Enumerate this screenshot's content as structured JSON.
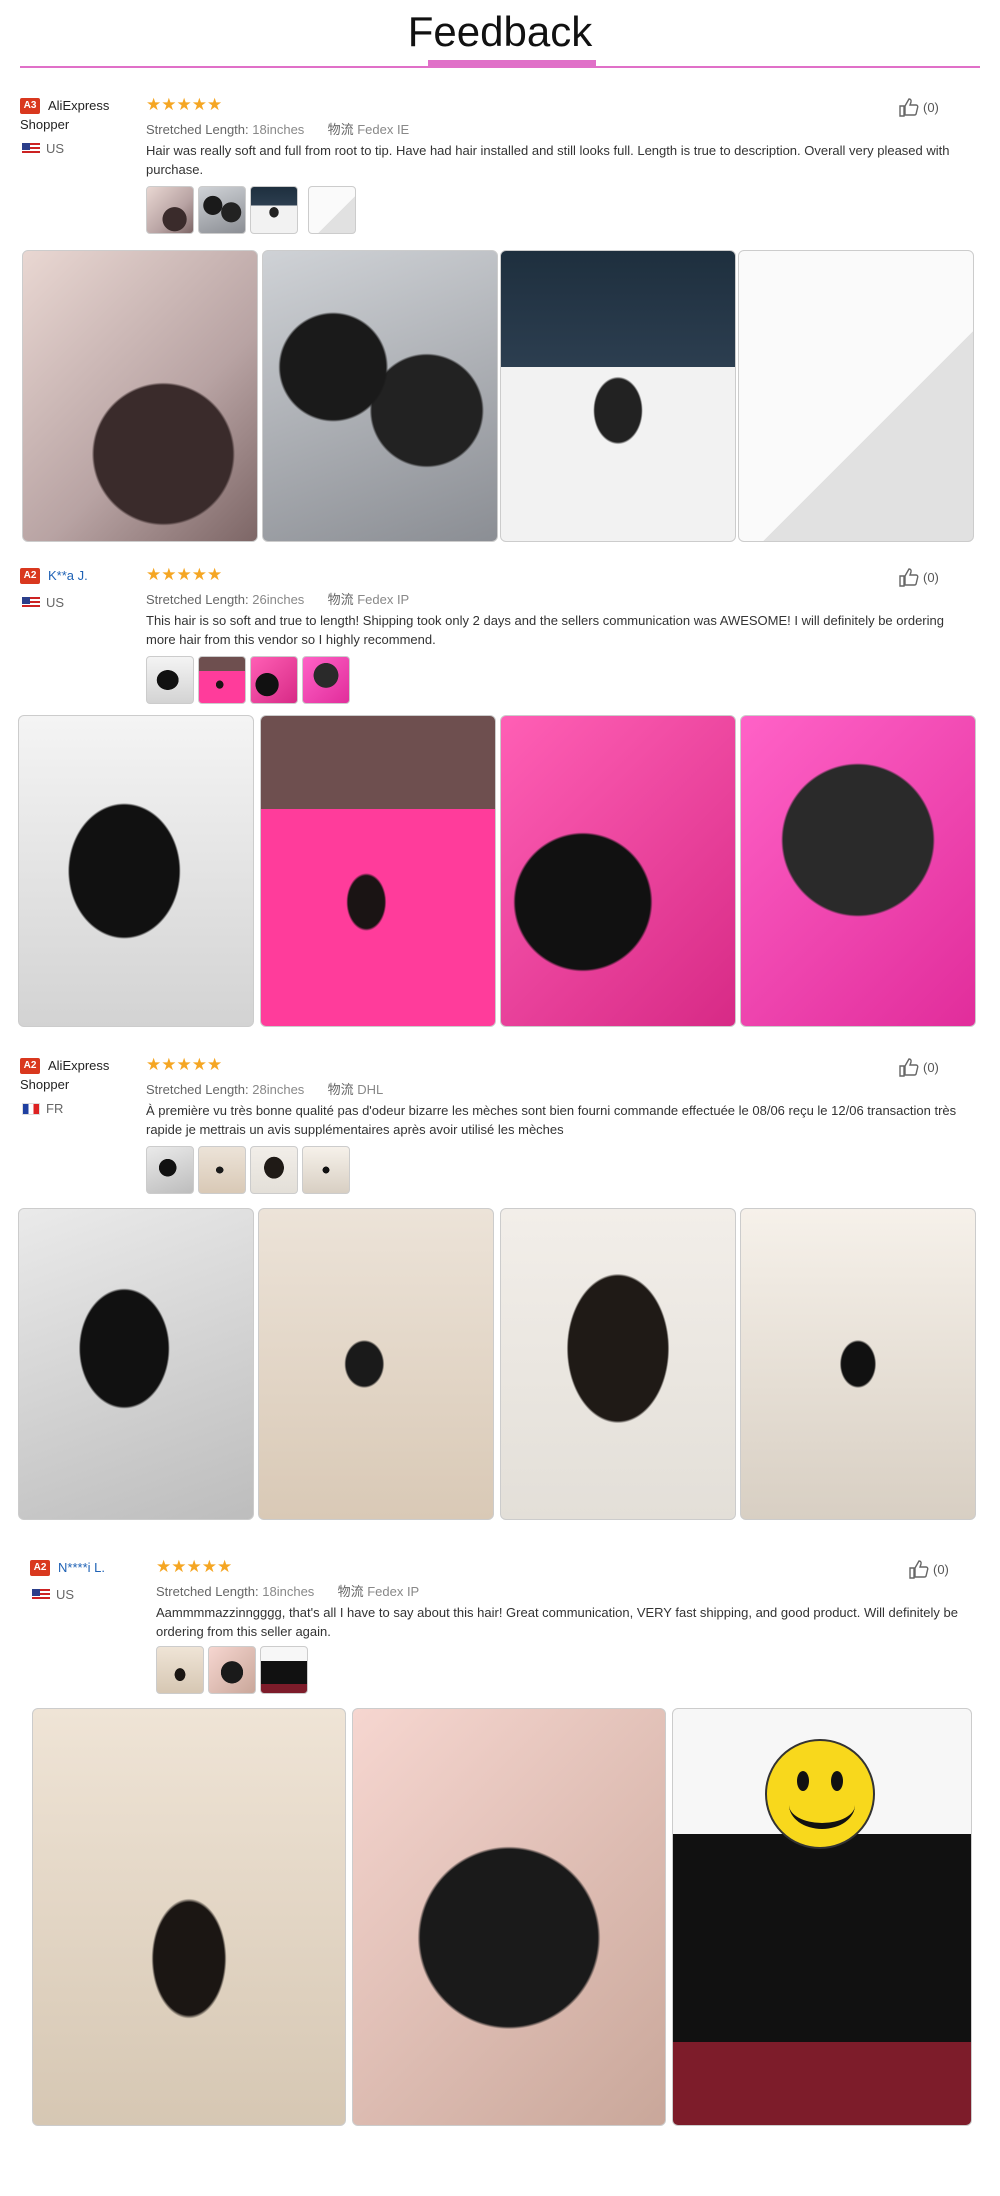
{
  "header": {
    "title": "Feedback"
  },
  "reviews": [
    {
      "badge": "A3",
      "user": "AliExpress Shopper",
      "country": "US",
      "stars": "★★★★★",
      "length_label": "Stretched Length:",
      "length_value": "18inches",
      "shipping_label": "物流",
      "shipping_value": "Fedex IE",
      "comment": "Hair was really soft and full from root to tip. Have had hair installed and still looks full. Length is true to description. Overall very pleased with purchase.",
      "helpful": "(0)"
    },
    {
      "badge": "A2",
      "user": "K**a J.",
      "country": "US",
      "stars": "★★★★★",
      "length_label": "Stretched Length:",
      "length_value": "26inches",
      "shipping_label": "物流",
      "shipping_value": "Fedex IP",
      "comment": "This hair is so soft and true to length! Shipping took only 2 days and the sellers communication was AWESOME! I will definitely be ordering more hair from this vendor so I highly recommend.",
      "helpful": "(0)"
    },
    {
      "badge": "A2",
      "user": "AliExpress Shopper",
      "country": "FR",
      "stars": "★★★★★",
      "length_label": "Stretched Length:",
      "length_value": "28inches",
      "shipping_label": "物流",
      "shipping_value": "DHL",
      "comment": "À première vu très bonne qualité pas d'odeur bizarre les mèches sont bien fourni commande effectuée le 08/06 reçu le 12/06 transaction très rapide je mettrais un avis supplémentaires après avoir utilisé les mèches",
      "helpful": "(0)"
    },
    {
      "badge": "A2",
      "user": "N****i L.",
      "country": "US",
      "stars": "★★★★★",
      "length_label": "Stretched Length:",
      "length_value": "18inches",
      "shipping_label": "物流",
      "shipping_value": "Fedex IP",
      "comment": "Aammmmazzinngggg, that's all I have to say about this hair! Great communication, VERY fast shipping, and good product. Will definitely be ordering from this seller again.",
      "helpful": "(0)"
    }
  ]
}
